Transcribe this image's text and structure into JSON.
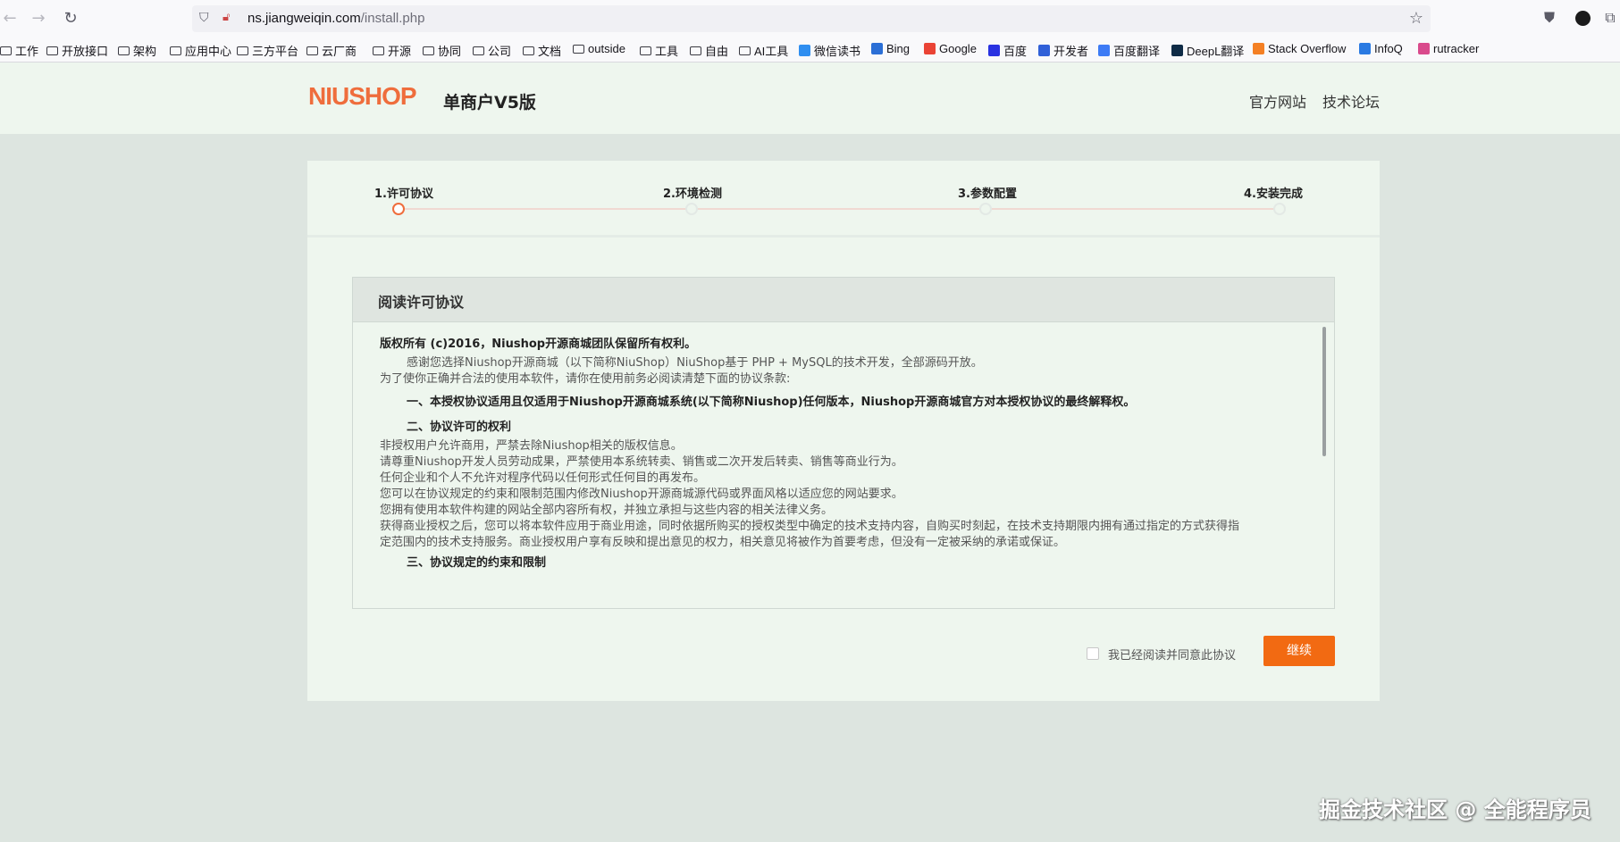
{
  "browser": {
    "url_domain": "ns.jiangweiqin.com",
    "url_path": "/install.php",
    "bookmarks": [
      {
        "label": "工作",
        "type": "folder"
      },
      {
        "label": "开放接口",
        "type": "folder"
      },
      {
        "label": "架构",
        "type": "folder"
      },
      {
        "label": "应用中心",
        "type": "folder"
      },
      {
        "label": "三方平台",
        "type": "folder"
      },
      {
        "label": "云厂商",
        "type": "folder"
      },
      {
        "label": "开源",
        "type": "folder"
      },
      {
        "label": "协同",
        "type": "folder"
      },
      {
        "label": "公司",
        "type": "folder"
      },
      {
        "label": "文档",
        "type": "folder"
      },
      {
        "label": "outside",
        "type": "folder"
      },
      {
        "label": "工具",
        "type": "folder"
      },
      {
        "label": "自由",
        "type": "folder"
      },
      {
        "label": "AI工具",
        "type": "folder"
      },
      {
        "label": "微信读书",
        "type": "site",
        "color": "#2f8ef0"
      },
      {
        "label": "Bing",
        "type": "site",
        "color": "#2b6fd6"
      },
      {
        "label": "Google",
        "type": "site",
        "color": "#ea4335"
      },
      {
        "label": "百度",
        "type": "site",
        "color": "#2932e1"
      },
      {
        "label": "开发者",
        "type": "site",
        "color": "#3060d8"
      },
      {
        "label": "百度翻译",
        "type": "site",
        "color": "#3d7bf5"
      },
      {
        "label": "DeepL翻译",
        "type": "site",
        "color": "#0f2b46"
      },
      {
        "label": "Stack Overflow",
        "type": "site",
        "color": "#f48024"
      },
      {
        "label": "InfoQ",
        "type": "site",
        "color": "#2a7ae2"
      },
      {
        "label": "rutracker",
        "type": "site",
        "color": "#d94a8c"
      }
    ]
  },
  "header": {
    "logo": "NIUSHOP",
    "edition": "单商户V5版",
    "links": [
      "官方网站",
      "技术论坛"
    ]
  },
  "steps": [
    {
      "label": "1.许可协议",
      "active": true
    },
    {
      "label": "2.环境检测",
      "active": false
    },
    {
      "label": "3.参数配置",
      "active": false
    },
    {
      "label": "4.安装完成",
      "active": false
    }
  ],
  "license": {
    "title": "阅读许可协议",
    "lines": [
      {
        "text": "版权所有 (c)2016，Niushop开源商城团队保留所有权利。",
        "bold": true,
        "indent": false
      },
      {
        "text": "感谢您选择Niushop开源商城（以下简称NiuShop）NiuShop基于 PHP + MySQL的技术开发，全部源码开放。",
        "bold": false,
        "indent": true
      },
      {
        "text": "为了使你正确并合法的使用本软件，请你在使用前务必阅读清楚下面的协议条款:",
        "bold": false,
        "indent": false
      },
      {
        "text": "一、本授权协议适用且仅适用于Niushop开源商城系统(以下简称Niushop)任何版本，Niushop开源商城官方对本授权协议的最终解释权。",
        "bold": true,
        "indent": true
      },
      {
        "text": "二、协议许可的权利",
        "bold": true,
        "indent": true
      },
      {
        "text": "非授权用户允许商用，严禁去除Niushop相关的版权信息。",
        "bold": false,
        "indent": false
      },
      {
        "text": "请尊重Niushop开发人员劳动成果，严禁使用本系统转卖、销售或二次开发后转卖、销售等商业行为。",
        "bold": false,
        "indent": false
      },
      {
        "text": "任何企业和个人不允许对程序代码以任何形式任何目的再发布。",
        "bold": false,
        "indent": false
      },
      {
        "text": "您可以在协议规定的约束和限制范围内修改Niushop开源商城源代码或界面风格以适应您的网站要求。",
        "bold": false,
        "indent": false
      },
      {
        "text": "您拥有使用本软件构建的网站全部内容所有权，并独立承担与这些内容的相关法律义务。",
        "bold": false,
        "indent": false
      },
      {
        "text": "获得商业授权之后，您可以将本软件应用于商业用途，同时依据所购买的授权类型中确定的技术支持内容，自购买时刻起，在技术支持期限内拥有通过指定的方式获得指",
        "bold": false,
        "indent": false
      },
      {
        "text": "定范围内的技术支持服务。商业授权用户享有反映和提出意见的权力，相关意见将被作为首要考虑，但没有一定被采纳的承诺或保证。",
        "bold": false,
        "indent": false
      },
      {
        "text": "三、协议规定的约束和限制",
        "bold": true,
        "indent": true
      }
    ]
  },
  "agree_label": "我已经阅读并同意此协议",
  "continue_label": "继续",
  "watermark": "掘金技术社区 @ 全能程序员"
}
